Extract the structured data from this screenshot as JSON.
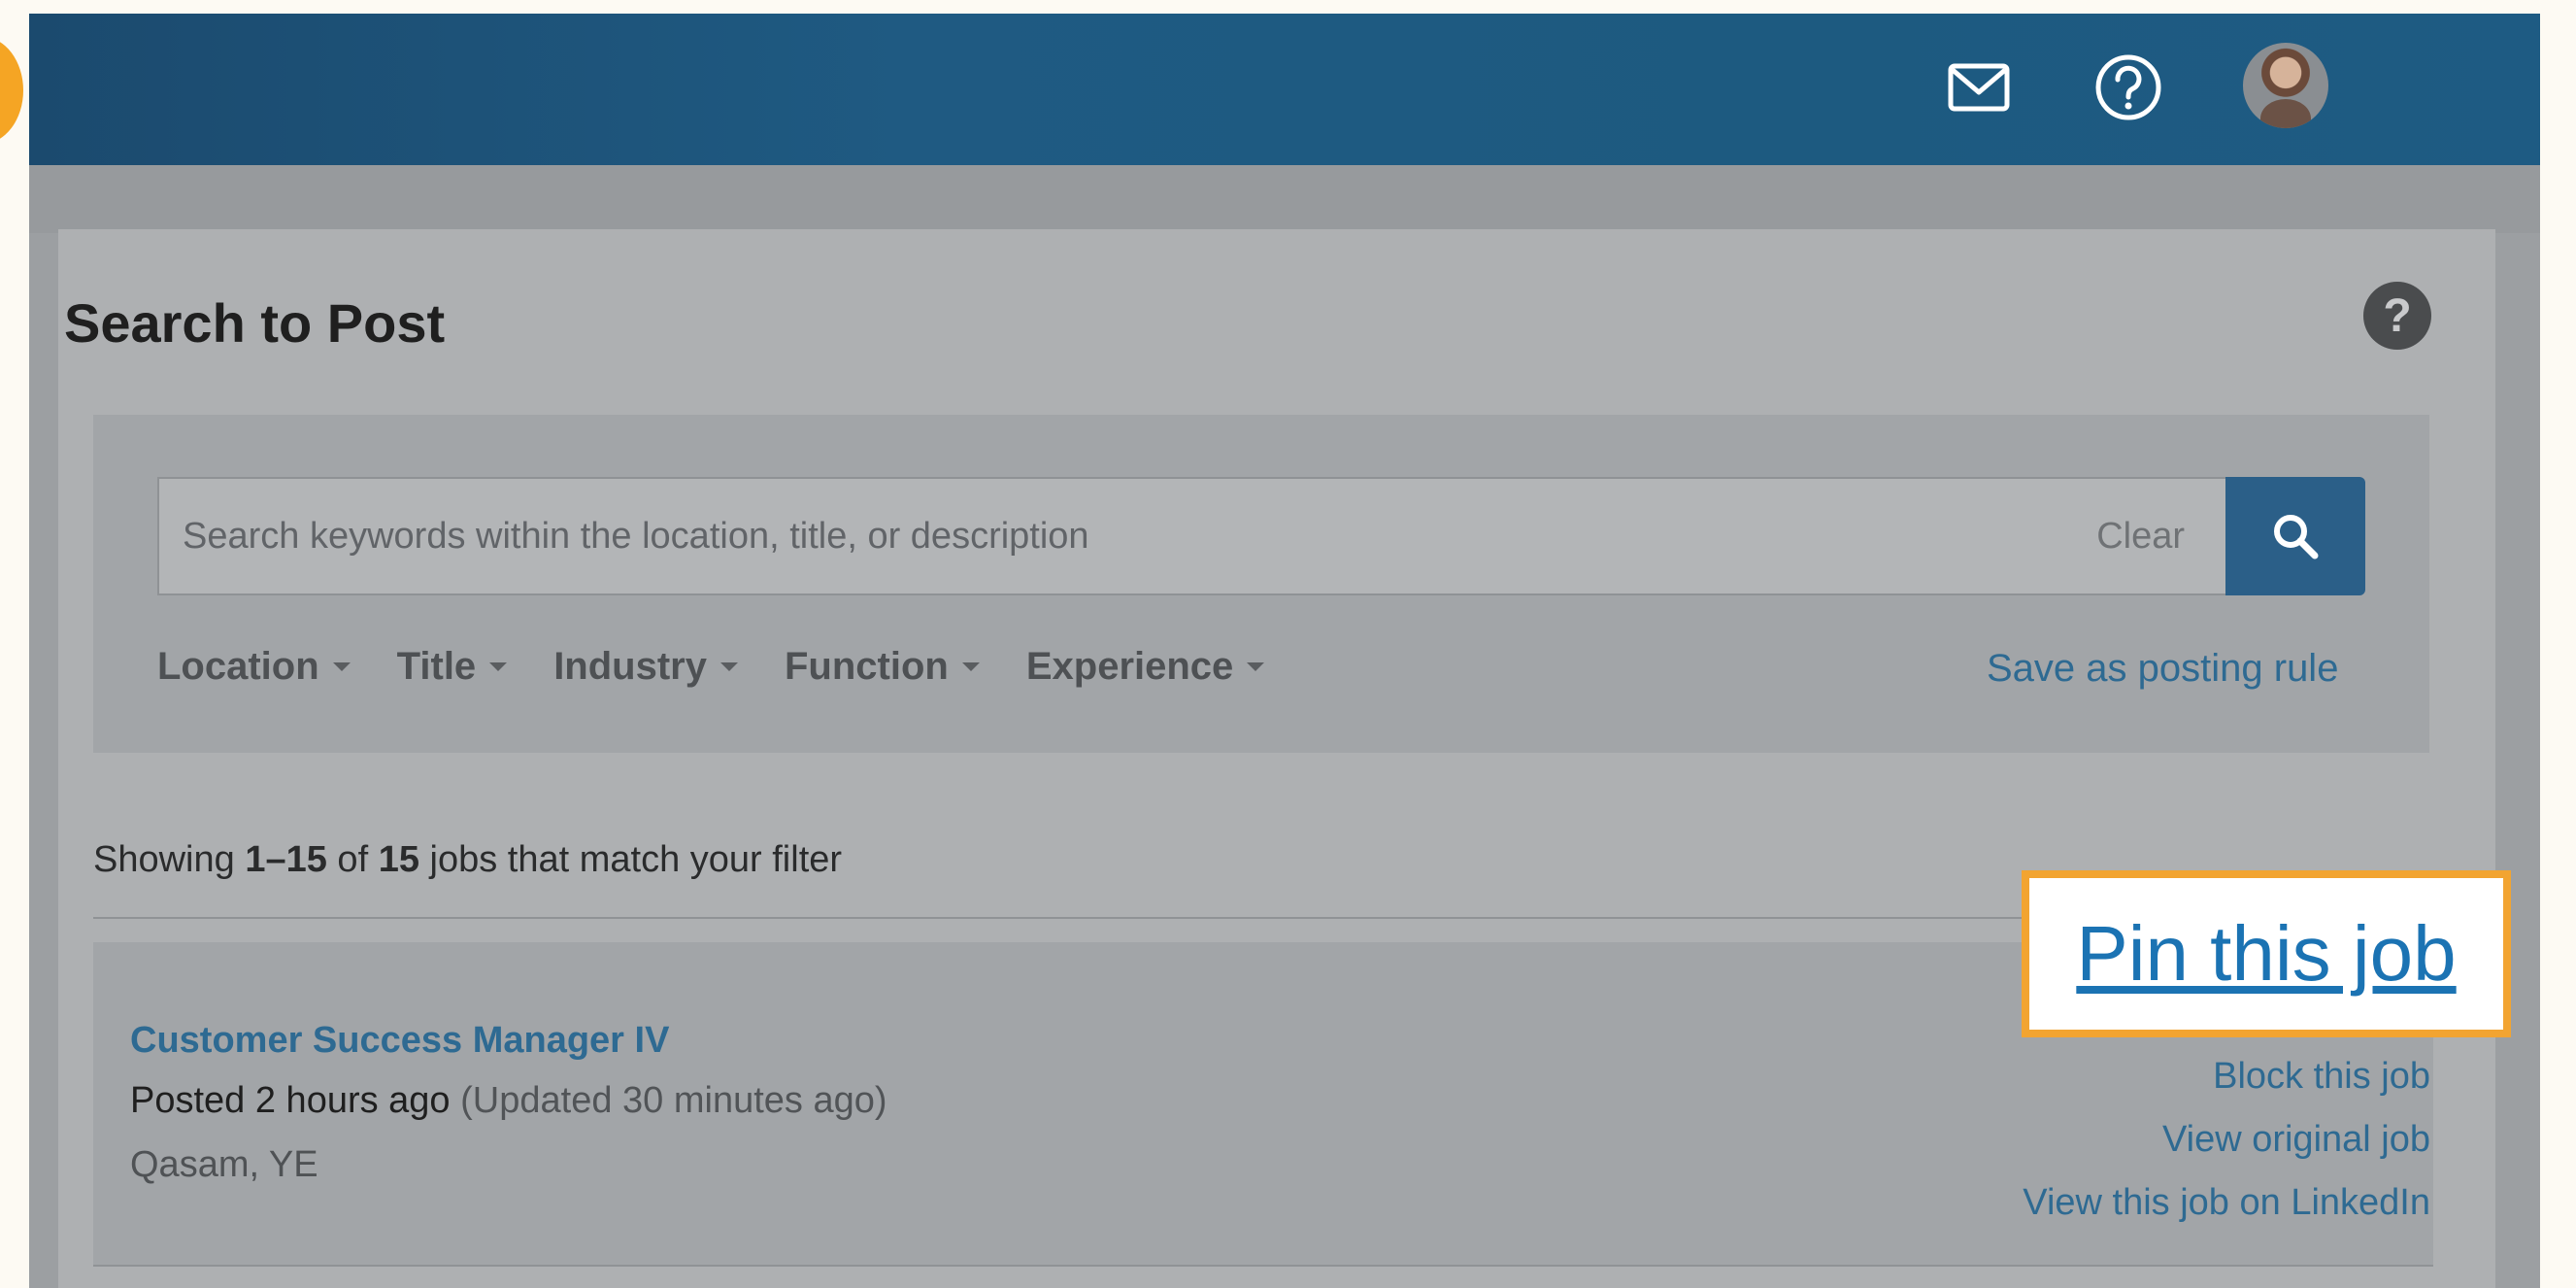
{
  "header": {
    "icons": [
      "mail-icon",
      "help-icon",
      "avatar"
    ]
  },
  "page": {
    "title": "Search to Post",
    "help_icon_label": "?"
  },
  "search": {
    "placeholder": "Search keywords within the location, title, or description",
    "value": "",
    "clear_label": "Clear"
  },
  "filters": [
    "Location",
    "Title",
    "Industry",
    "Function",
    "Experience"
  ],
  "save_rule_label": "Save as posting rule",
  "results": {
    "prefix": "Showing ",
    "range": "1–15",
    "of": " of ",
    "total": "15",
    "suffix": " jobs that match your filter"
  },
  "job": {
    "title": "Customer Success Manager IV",
    "posted": "Posted 2 hours ago",
    "updated": "(Updated 30 minutes ago)",
    "location": "Qasam, YE",
    "actions": {
      "pin": "Pin this job",
      "block": "Block this job",
      "view_original": "View original job",
      "view_linkedin": "View this job on LinkedIn"
    }
  },
  "colors": {
    "accent_highlight": "#f2a431",
    "link": "#2e6a92",
    "topbar": "#1f5a82"
  }
}
